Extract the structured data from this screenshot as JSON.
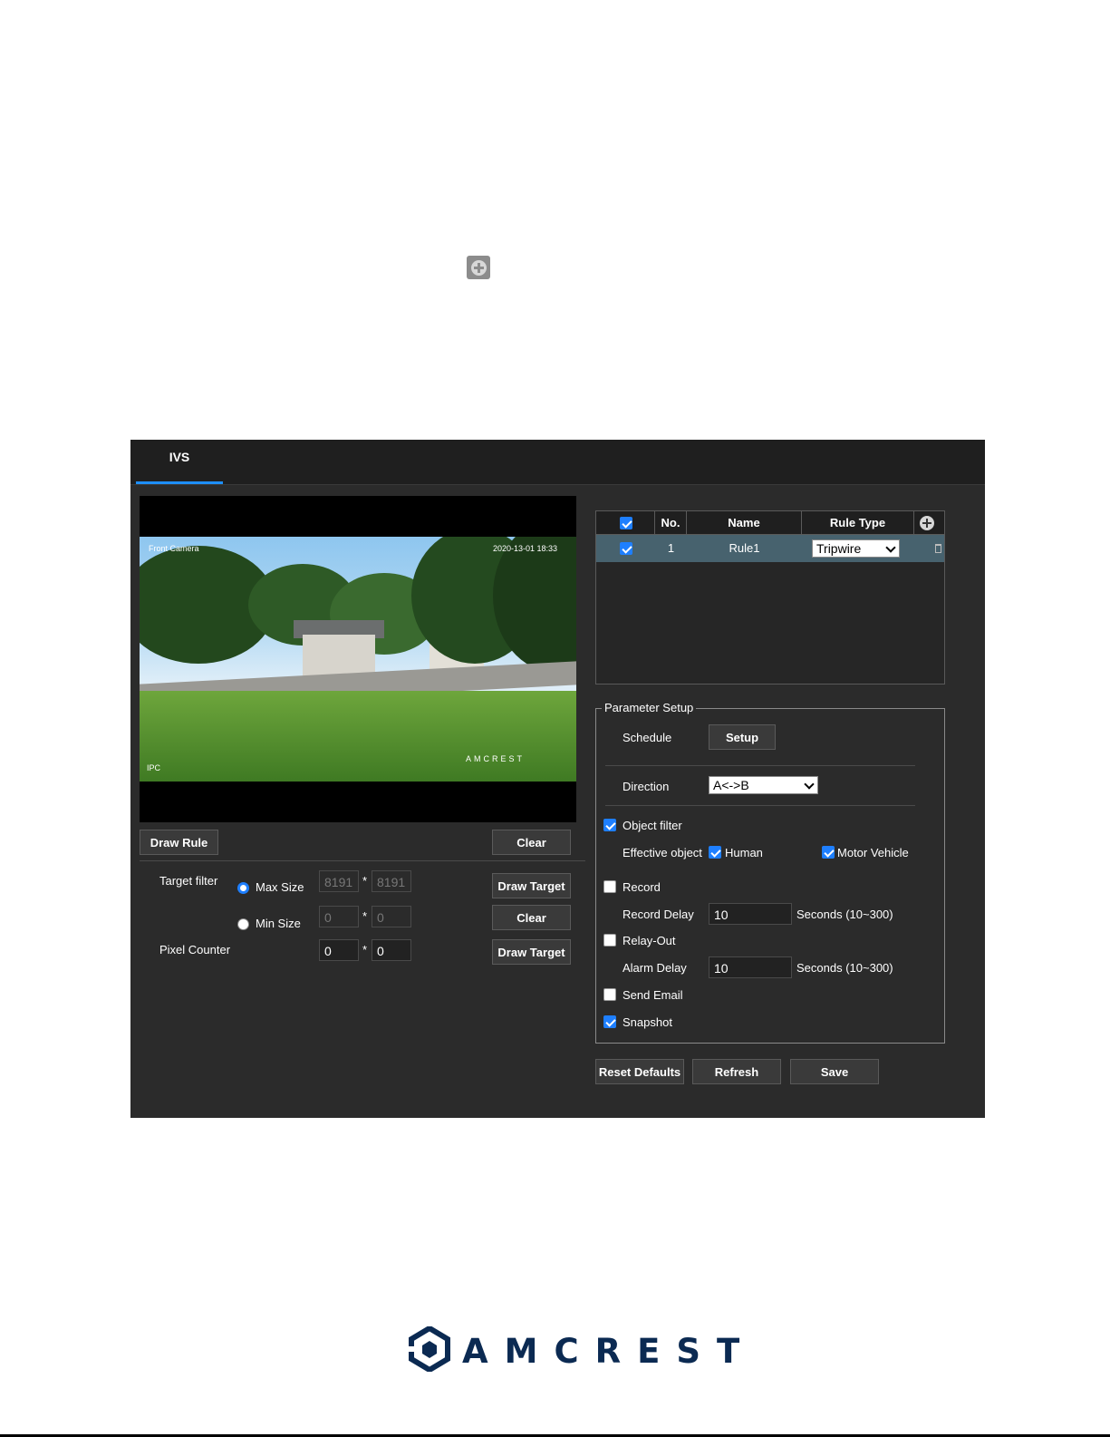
{
  "tab": "IVS",
  "video_osd": {
    "top_left": "Front Camera",
    "top_right": "2020-13-01 18:33",
    "bottom_left": "IPC",
    "watermark": "AMCREST"
  },
  "left": {
    "draw_rule": "Draw Rule",
    "clear1": "Clear",
    "target_filter": "Target filter",
    "max_size": "Max Size",
    "min_size": "Min Size",
    "max_w": "8191",
    "max_h": "8191",
    "min_w": "0",
    "min_h": "0",
    "star": "*",
    "draw_target1": "Draw Target",
    "clear2": "Clear",
    "pixel_counter": "Pixel Counter",
    "pc_w": "0",
    "pc_h": "0",
    "draw_target2": "Draw Target"
  },
  "rules_table": {
    "headers": {
      "no": "No.",
      "name": "Name",
      "rule_type": "Rule Type"
    },
    "rows": [
      {
        "no": "1",
        "name": "Rule1",
        "rule_type": "Tripwire",
        "checked": true
      }
    ]
  },
  "params": {
    "legend": "Parameter Setup",
    "schedule": "Schedule",
    "setup_btn": "Setup",
    "direction": "Direction",
    "direction_value": "A<->B",
    "object_filter": "Object filter",
    "effective_object": "Effective object",
    "human": "Human",
    "motor_vehicle": "Motor Vehicle",
    "record": "Record",
    "record_delay": "Record Delay",
    "record_delay_value": "10",
    "seconds_hint1": "Seconds (10~300)",
    "relay_out": "Relay-Out",
    "alarm_delay": "Alarm Delay",
    "alarm_delay_value": "10",
    "seconds_hint2": "Seconds (10~300)",
    "send_email": "Send Email",
    "snapshot": "Snapshot"
  },
  "footer_buttons": {
    "reset": "Reset Defaults",
    "refresh": "Refresh",
    "save": "Save"
  },
  "brand": "AMCREST",
  "colors": {
    "accent": "#1e7fff",
    "panel": "#2b2b2b",
    "row_selected": "#47626e",
    "brand": "#0b2a52"
  }
}
